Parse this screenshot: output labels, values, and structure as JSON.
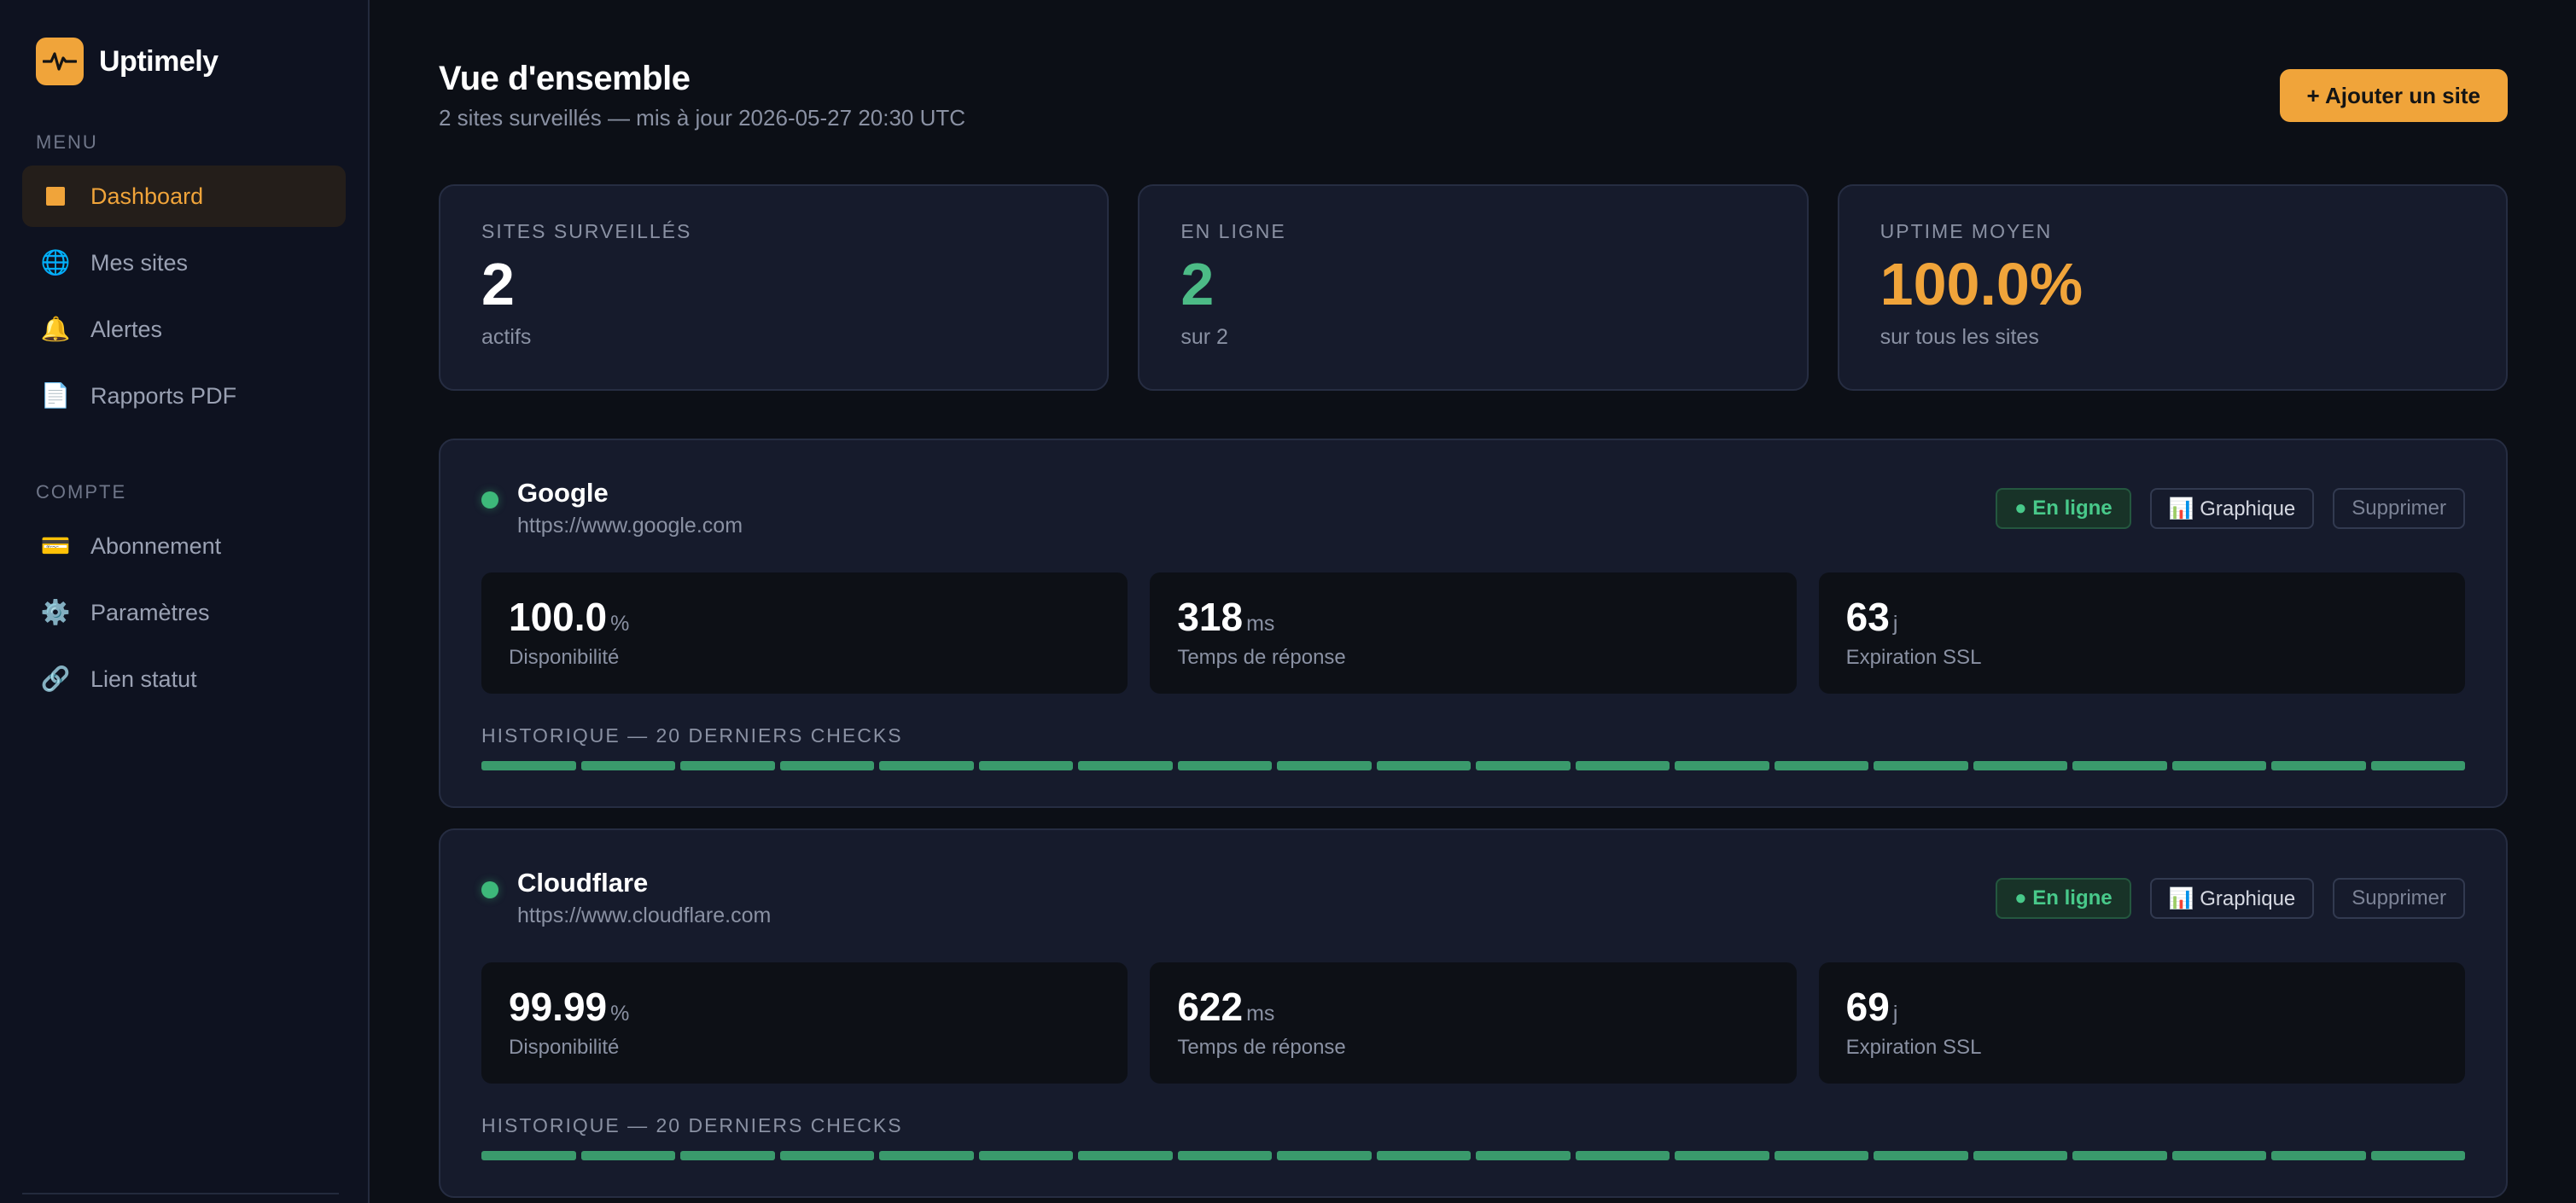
{
  "app": {
    "name": "Uptimely"
  },
  "sidebar": {
    "menu_title": "MENU",
    "menu_items": [
      {
        "label": "Dashboard",
        "icon": "dashboard-square-icon",
        "glyph": "",
        "active": true
      },
      {
        "label": "Mes sites",
        "icon": "globe-icon",
        "glyph": "🌐"
      },
      {
        "label": "Alertes",
        "icon": "bell-icon",
        "glyph": "🔔"
      },
      {
        "label": "Rapports PDF",
        "icon": "document-icon",
        "glyph": "📄"
      }
    ],
    "account_title": "COMPTE",
    "account_items": [
      {
        "label": "Abonnement",
        "icon": "credit-card-icon",
        "glyph": "💳"
      },
      {
        "label": "Paramètres",
        "icon": "gear-icon",
        "glyph": "⚙️"
      },
      {
        "label": "Lien statut",
        "icon": "link-icon",
        "glyph": "🔗"
      }
    ]
  },
  "header": {
    "title": "Vue d'ensemble",
    "subtitle": "2 sites surveillés — mis à jour 2026-05-27 20:30 UTC",
    "add_button": "+ Ajouter un site"
  },
  "stats": [
    {
      "label": "SITES SURVEILLÉS",
      "value": "2",
      "sub": "actifs",
      "color": "#ffffff"
    },
    {
      "label": "EN LIGNE",
      "value": "2",
      "sub": "sur 2",
      "color": "#4cbb86"
    },
    {
      "label": "UPTIME MOYEN",
      "value": "100.0%",
      "sub": "sur tous les sites",
      "color": "#f0a43a"
    }
  ],
  "sites": [
    {
      "name": "Google",
      "url": "https://www.google.com",
      "status": "● En ligne",
      "chart_button": "📊 Graphique",
      "delete_button": "Supprimer",
      "metrics": [
        {
          "value": "100.0",
          "unit": "%",
          "label": "Disponibilité"
        },
        {
          "value": "318",
          "unit": "ms",
          "label": "Temps de réponse"
        },
        {
          "value": "63",
          "unit": "j",
          "label": "Expiration SSL"
        }
      ],
      "history_label": "HISTORIQUE — 20 DERNIERS CHECKS",
      "history": [
        "up",
        "up",
        "up",
        "up",
        "up",
        "up",
        "up",
        "up",
        "up",
        "up",
        "up",
        "up",
        "up",
        "up",
        "up",
        "up",
        "up",
        "up",
        "up",
        "up"
      ]
    },
    {
      "name": "Cloudflare",
      "url": "https://www.cloudflare.com",
      "status": "● En ligne",
      "chart_button": "📊 Graphique",
      "delete_button": "Supprimer",
      "metrics": [
        {
          "value": "99.99",
          "unit": "%",
          "label": "Disponibilité"
        },
        {
          "value": "622",
          "unit": "ms",
          "label": "Temps de réponse"
        },
        {
          "value": "69",
          "unit": "j",
          "label": "Expiration SSL"
        }
      ],
      "history_label": "HISTORIQUE — 20 DERNIERS CHECKS",
      "history": [
        "up",
        "up",
        "up",
        "up",
        "up",
        "up",
        "up",
        "up",
        "up",
        "up",
        "up",
        "up",
        "up",
        "up",
        "up",
        "up",
        "up",
        "up",
        "up",
        "up"
      ]
    }
  ],
  "colors": {
    "accent": "#f0a43a",
    "online": "#3db87a",
    "history_up": "#3a9a6c",
    "history_down": "#d9534f"
  }
}
